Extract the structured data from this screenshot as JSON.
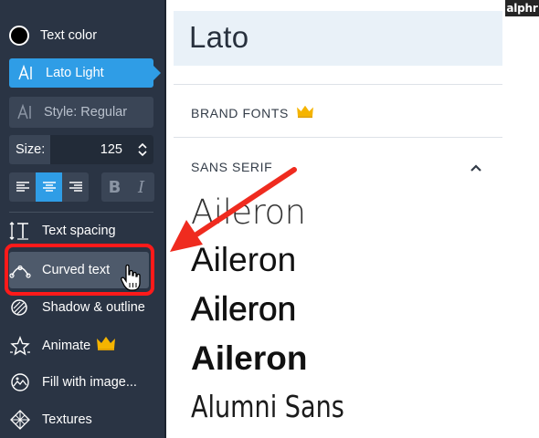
{
  "sidebar": {
    "text_color_label": "Text color",
    "font_button_label": "Lato Light",
    "style_label": "Style: Regular",
    "size_label": "Size:",
    "size_value": "125",
    "format": {
      "bold": "B",
      "italic": "I"
    },
    "tools": [
      {
        "label": "Text spacing"
      },
      {
        "label": "Curved text"
      },
      {
        "label": "Shadow & outline"
      },
      {
        "label": "Animate"
      },
      {
        "label": "Fill with image..."
      },
      {
        "label": "Textures"
      }
    ]
  },
  "panel": {
    "search_value": "Lato",
    "brand_fonts_label": "BRAND FONTS",
    "sans_serif_label": "SANS SERIF",
    "font_samples": [
      "Aileron",
      "Aileron",
      "Aileron",
      "Aileron",
      "Alumni Sans"
    ]
  },
  "logo_text": "alphr",
  "colors": {
    "sidebar_bg": "#2a3444",
    "accent_blue": "#2f9de6",
    "highlight_red": "#ff1a1a",
    "crown_gold": "#f5b400"
  }
}
